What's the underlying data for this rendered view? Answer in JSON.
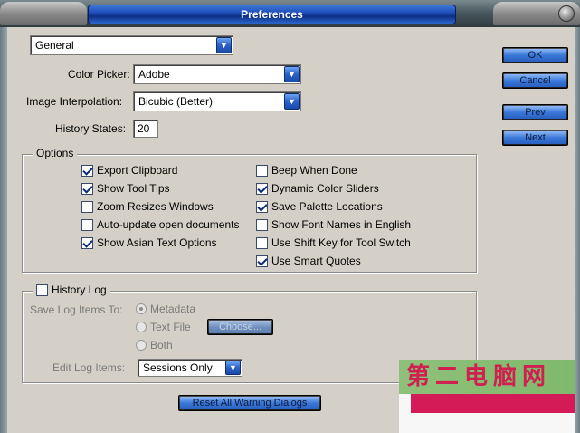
{
  "window": {
    "title": "Preferences"
  },
  "category": {
    "value": "General"
  },
  "fields": {
    "color_picker_label": "Color Picker:",
    "color_picker_value": "Adobe",
    "interpolation_label": "Image Interpolation:",
    "interpolation_value": "Bicubic (Better)",
    "history_states_label": "History States:",
    "history_states_value": "20"
  },
  "options": {
    "group_label": "Options",
    "left": [
      {
        "label": "Export Clipboard",
        "checked": true
      },
      {
        "label": "Show Tool Tips",
        "checked": true
      },
      {
        "label": "Zoom Resizes Windows",
        "checked": false
      },
      {
        "label": "Auto-update open documents",
        "checked": false
      },
      {
        "label": "Show Asian Text Options",
        "checked": true
      }
    ],
    "right": [
      {
        "label": "Beep When Done",
        "checked": false
      },
      {
        "label": "Dynamic Color Sliders",
        "checked": true
      },
      {
        "label": "Save Palette Locations",
        "checked": true
      },
      {
        "label": "Show Font Names in English",
        "checked": false
      },
      {
        "label": "Use Shift Key for Tool Switch",
        "checked": false
      },
      {
        "label": "Use Smart Quotes",
        "checked": true
      }
    ]
  },
  "history_log": {
    "label": "History Log",
    "checked": false,
    "save_to_label": "Save Log Items To:",
    "radios": [
      "Metadata",
      "Text File",
      "Both"
    ],
    "selected": "Metadata",
    "choose_label": "Choose...",
    "edit_label": "Edit Log Items:",
    "edit_value": "Sessions Only"
  },
  "buttons": {
    "ok": "OK",
    "cancel": "Cancel",
    "prev": "Prev",
    "next": "Next",
    "reset_warnings": "Reset All Warning Dialogs"
  },
  "watermark": {
    "text": "第二电脑网"
  },
  "colors": {
    "accent_blue": "#2a62c8",
    "title_blue": "#1e4fb8",
    "watermark_green": "#8fc07a",
    "watermark_pink": "#d41b57"
  },
  "icons": {
    "dropdown": "chevron-down-icon",
    "close": "close-icon"
  }
}
